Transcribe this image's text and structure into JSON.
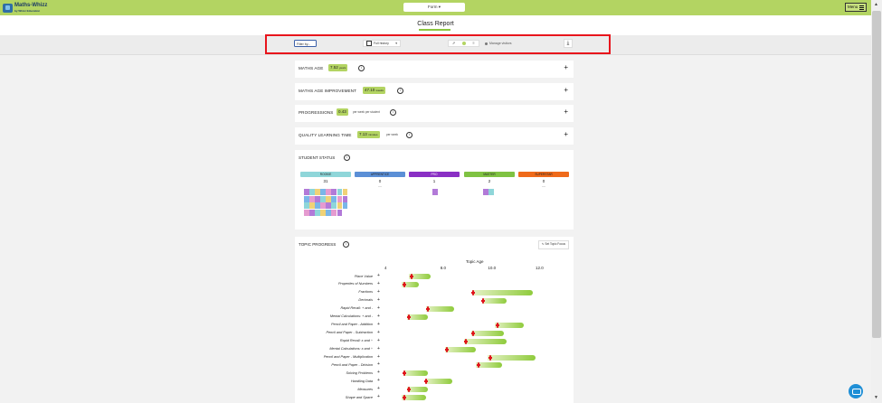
{
  "header": {
    "logo_text": "Maths-Whizz",
    "logo_sub": "by Whizz Education",
    "form_select": "Form",
    "menu_label": "Menu"
  },
  "page": {
    "title": "Class Report"
  },
  "toolbar": {
    "filter_label": "Filter by...",
    "history_label": "Full history",
    "manage_label": "Manage visitors"
  },
  "metrics": [
    {
      "label": "MATHS AGE",
      "value": "7.52",
      "unit": "years",
      "suffix": ""
    },
    {
      "label": "MATHS AGE IMPROVEMENT",
      "value": "47.10",
      "unit": "weeks",
      "suffix": ""
    },
    {
      "label": "PROGRESSIONS",
      "value": "0.43",
      "unit": "",
      "suffix": "per week per student"
    },
    {
      "label": "QUALITY LEARNING TIME",
      "value": "7.13",
      "unit": "minutes",
      "suffix": "per week"
    }
  ],
  "student_status": {
    "title": "STUDENT STATUS",
    "levels": [
      {
        "name": "ROOKIE",
        "count": "31",
        "color": "#8fd6d9"
      },
      {
        "name": "APPRENTICE",
        "count": "0",
        "color": "#5b8fd6"
      },
      {
        "name": "PRO",
        "count": "1",
        "color": "#8a2fc4"
      },
      {
        "name": "MASTER",
        "count": "2",
        "color": "#7fc242"
      },
      {
        "name": "SUPERSTAR",
        "count": "0",
        "color": "#ef6a1a"
      }
    ],
    "empty_mark": "—"
  },
  "topic_progress": {
    "title": "TOPIC PROGRESS",
    "set_focus_label": "Set Topic Focus"
  },
  "chart_data": {
    "type": "bar",
    "xlabel": "Topic Age",
    "ylabel": "",
    "x_ticks": [
      "4",
      "8.0",
      "10.0",
      "12.0"
    ],
    "xlim": [
      5.5,
      12.8
    ],
    "categories": [
      "Place Value",
      "Properties of Numbers",
      "Fractions",
      "Decimals",
      "Rapid Recall: + and -",
      "Mental Calculations: + and -",
      "Pencil and Paper - Addition",
      "Pencil and Paper - Subtraction",
      "Rapid Recall: x and ÷",
      "Mental Calculations: x and ÷",
      "Pencil and Paper - Multiplication",
      "Pencil and Paper - Division",
      "Solving Problems",
      "Handling Data",
      "Measures",
      "Shape and Space"
    ],
    "series": [
      {
        "values": [
          [
            6.5,
            7.4
          ],
          [
            6.2,
            6.9
          ],
          [
            9.2,
            11.7
          ],
          [
            9.6,
            10.6
          ],
          [
            7.2,
            8.4
          ],
          [
            6.4,
            7.3
          ],
          [
            10.1,
            11.3
          ],
          [
            9.1,
            10.5
          ],
          [
            8.8,
            10.6
          ],
          [
            8.0,
            9.3
          ],
          [
            9.8,
            11.8
          ],
          [
            9.3,
            10.4
          ],
          [
            6.3,
            7.3
          ],
          [
            7.2,
            8.3
          ],
          [
            6.4,
            7.3
          ],
          [
            6.2,
            7.2
          ]
        ]
      },
      {
        "values": [
          6.6,
          6.3,
          9.2,
          9.6,
          7.3,
          6.5,
          10.2,
          9.2,
          8.9,
          8.1,
          9.9,
          9.4,
          6.3,
          7.2,
          6.5,
          6.3
        ]
      }
    ]
  }
}
